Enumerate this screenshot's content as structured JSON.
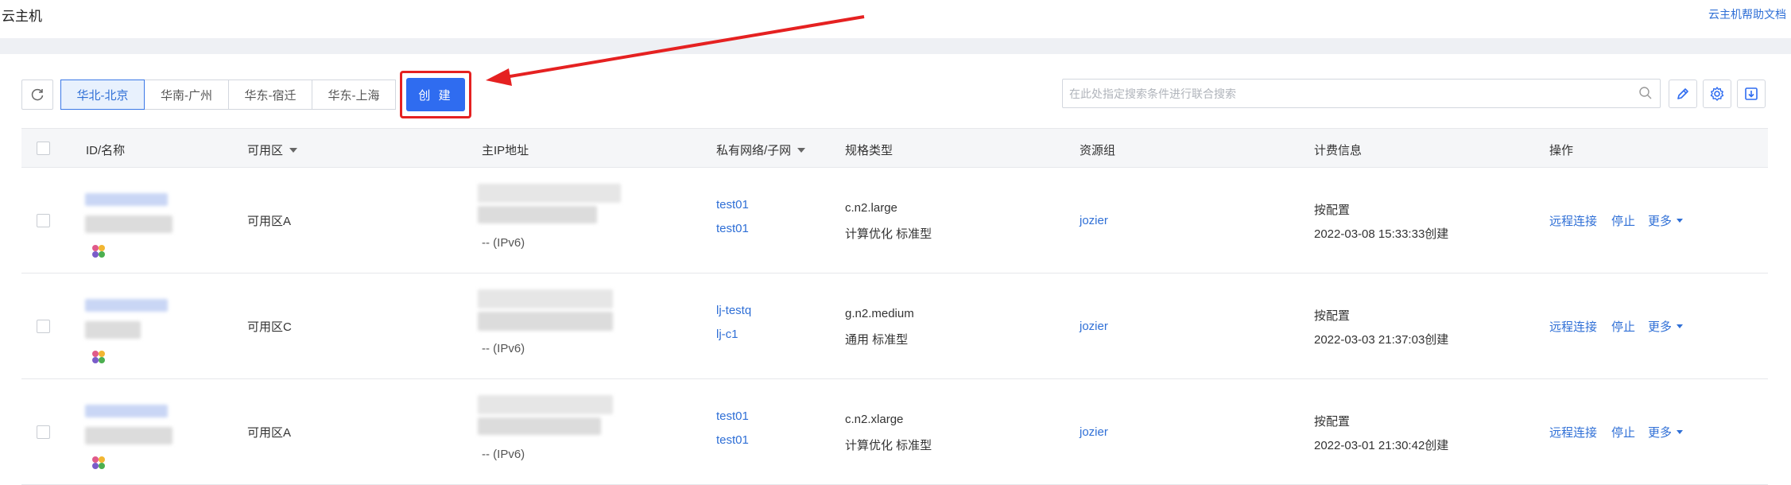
{
  "header": {
    "title": "云主机",
    "doc_link": "云主机帮助文档"
  },
  "toolbar": {
    "regions": [
      "华北-北京",
      "华南-广州",
      "华东-宿迁",
      "华东-上海"
    ],
    "active_region": "华北-北京",
    "create_label": "创 建",
    "search_placeholder": "在此处指定搜索条件进行联合搜索",
    "search_value": ""
  },
  "table": {
    "headers": {
      "id": "ID/名称",
      "zone": "可用区",
      "ip": "主IP地址",
      "vpc": "私有网络/子网",
      "spec": "规格类型",
      "group": "资源组",
      "billing": "计费信息",
      "actions": "操作"
    },
    "rows": [
      {
        "zone": "可用区A",
        "ipv6": "-- (IPv6)",
        "vpc": "test01",
        "subnet": "test01",
        "spec": "c.n2.large",
        "spec_desc": "计算优化 标准型",
        "group": "jozier",
        "billing": "按配置",
        "created": "2022-03-08 15:33:33创建"
      },
      {
        "zone": "可用区C",
        "ipv6": "-- (IPv6)",
        "vpc": "lj-testq",
        "subnet": "lj-c1",
        "spec": "g.n2.medium",
        "spec_desc": "通用 标准型",
        "group": "jozier",
        "billing": "按配置",
        "created": "2022-03-03 21:37:03创建"
      },
      {
        "zone": "可用区A",
        "ipv6": "-- (IPv6)",
        "vpc": "test01",
        "subnet": "test01",
        "spec": "c.n2.xlarge",
        "spec_desc": "计算优化 标准型",
        "group": "jozier",
        "billing": "按配置",
        "created": "2022-03-01 21:30:42创建"
      }
    ],
    "action_labels": {
      "remote": "远程连接",
      "stop": "停止",
      "more": "更多"
    }
  },
  "colors": {
    "accent": "#2f6cf0",
    "link": "#2f6fd6",
    "highlight": "#e52121"
  },
  "icons": [
    "refresh-icon",
    "search-icon",
    "edit-icon",
    "gear-icon",
    "download-icon",
    "os-icon",
    "arrow-annotation"
  ]
}
